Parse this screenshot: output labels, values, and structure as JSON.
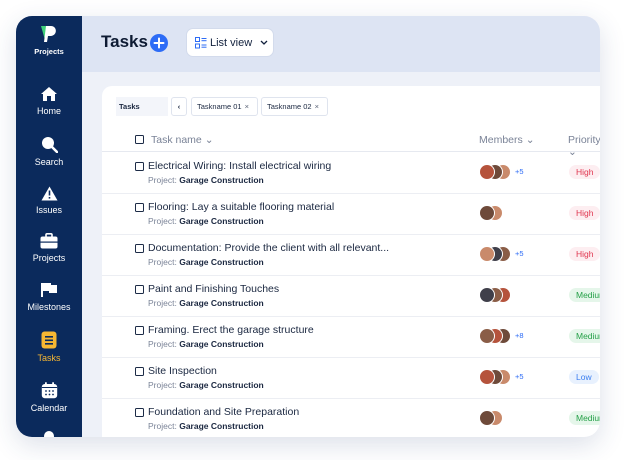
{
  "sidebar": {
    "logo_label": "Projects",
    "items": [
      {
        "label": "Home",
        "icon": "home-icon"
      },
      {
        "label": "Search",
        "icon": "search-icon"
      },
      {
        "label": "Issues",
        "icon": "warning-icon"
      },
      {
        "label": "Projects",
        "icon": "briefcase-icon"
      },
      {
        "label": "Milestones",
        "icon": "flag-icon"
      },
      {
        "label": "Tasks",
        "icon": "tasks-icon"
      },
      {
        "label": "Calendar",
        "icon": "calendar-icon"
      }
    ],
    "active_item": "Tasks",
    "colors": {
      "background": "#0b2a5c",
      "active": "#f7b733"
    }
  },
  "header": {
    "title": "Tasks",
    "view_label": "List view",
    "colors": {
      "add_button": "#2d6cf6",
      "background": "#dde4f3"
    }
  },
  "tabs": {
    "active": "Tasks",
    "back_glyph": "‹",
    "files": [
      {
        "label": "Taskname 01",
        "close": "×"
      },
      {
        "label": "Taskname 02",
        "close": "×"
      }
    ]
  },
  "table": {
    "columns": {
      "task": "Task name",
      "members": "Members",
      "priority": "Priority"
    },
    "sort_glyph": "⌄",
    "rows": [
      {
        "name": "Electrical Wiring: Install electrical wiring",
        "project_label": "Project:",
        "project": "Garage Construction",
        "avatars": 3,
        "more": "+5",
        "priority": "High"
      },
      {
        "name": "Flooring: Lay a suitable flooring material",
        "project_label": "Project:",
        "project": "Garage Construction",
        "avatars": 2,
        "more": "",
        "priority": "High"
      },
      {
        "name": "Documentation: Provide the client with all relevant...",
        "project_label": "Project:",
        "project": "Garage Construction",
        "avatars": 3,
        "more": "+5",
        "priority": "High"
      },
      {
        "name": "Paint and Finishing Touches",
        "project_label": "Project:",
        "project": "Garage Construction",
        "avatars": 3,
        "more": "",
        "priority": "Medium"
      },
      {
        "name": "Framing. Erect the garage structure",
        "project_label": "Project:",
        "project": "Garage Construction",
        "avatars": 3,
        "more": "+8",
        "priority": "Medium"
      },
      {
        "name": "Site Inspection",
        "project_label": "Project:",
        "project": "Garage Construction",
        "avatars": 3,
        "more": "+5",
        "priority": "Low"
      },
      {
        "name": "Foundation and Site Preparation",
        "project_label": "Project:",
        "project": "Garage Construction",
        "avatars": 2,
        "more": "",
        "priority": "Medium"
      }
    ]
  },
  "priority_colors": {
    "High": "#e0354f",
    "Medium": "#24a047",
    "Low": "#3b7ef0"
  }
}
